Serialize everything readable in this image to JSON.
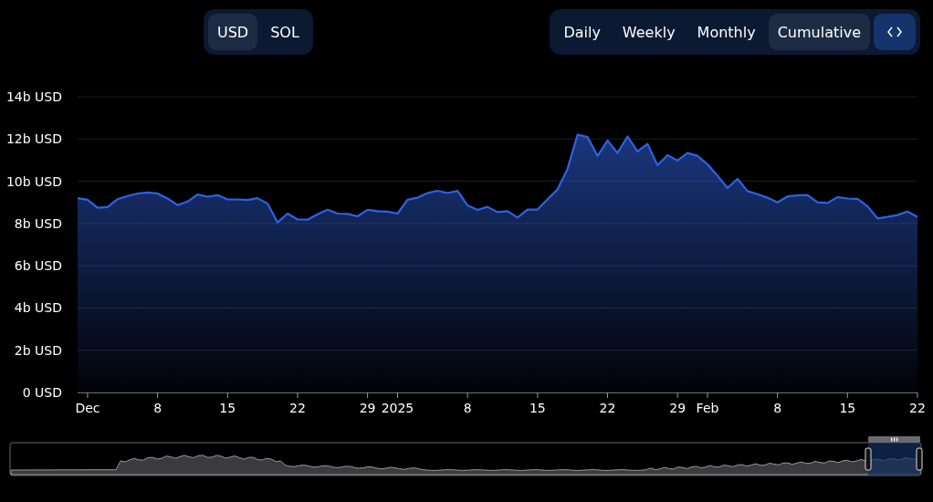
{
  "currency_toggle": [
    {
      "label": "USD",
      "selected": true
    },
    {
      "label": "SOL",
      "selected": false
    }
  ],
  "period_toggle": [
    {
      "label": "Daily",
      "selected": false
    },
    {
      "label": "Weekly",
      "selected": false
    },
    {
      "label": "Monthly",
      "selected": false
    },
    {
      "label": "Cumulative",
      "selected": true
    }
  ],
  "chart": {
    "chart_data": {
      "type": "area",
      "grid": true,
      "ylim": [
        0,
        14
      ],
      "xlim": [
        "2024-11-30",
        "2025-02-22"
      ],
      "x": [
        "2024-11-30",
        "2024-12-01",
        "2024-12-02",
        "2024-12-03",
        "2024-12-04",
        "2024-12-05",
        "2024-12-06",
        "2024-12-07",
        "2024-12-08",
        "2024-12-09",
        "2024-12-10",
        "2024-12-11",
        "2024-12-12",
        "2024-12-13",
        "2024-12-14",
        "2024-12-15",
        "2024-12-16",
        "2024-12-17",
        "2024-12-18",
        "2024-12-19",
        "2024-12-20",
        "2024-12-21",
        "2024-12-22",
        "2024-12-23",
        "2024-12-24",
        "2024-12-25",
        "2024-12-26",
        "2024-12-27",
        "2024-12-28",
        "2024-12-29",
        "2024-12-30",
        "2024-12-31",
        "2025-01-01",
        "2025-01-02",
        "2025-01-03",
        "2025-01-04",
        "2025-01-05",
        "2025-01-06",
        "2025-01-07",
        "2025-01-08",
        "2025-01-09",
        "2025-01-10",
        "2025-01-11",
        "2025-01-12",
        "2025-01-13",
        "2025-01-14",
        "2025-01-15",
        "2025-01-16",
        "2025-01-17",
        "2025-01-18",
        "2025-01-19",
        "2025-01-20",
        "2025-01-21",
        "2025-01-22",
        "2025-01-23",
        "2025-01-24",
        "2025-01-25",
        "2025-01-26",
        "2025-01-27",
        "2025-01-28",
        "2025-01-29",
        "2025-01-30",
        "2025-01-31",
        "2025-02-01",
        "2025-02-02",
        "2025-02-03",
        "2025-02-04",
        "2025-02-05",
        "2025-02-06",
        "2025-02-07",
        "2025-02-08",
        "2025-02-09",
        "2025-02-10",
        "2025-02-11",
        "2025-02-12",
        "2025-02-13",
        "2025-02-14",
        "2025-02-15",
        "2025-02-16",
        "2025-02-17",
        "2025-02-18",
        "2025-02-19",
        "2025-02-20",
        "2025-02-21",
        "2025-02-22"
      ],
      "yticks": [
        {
          "value": 0,
          "label": "0 USD"
        },
        {
          "value": 2,
          "label": "2b USD"
        },
        {
          "value": 4,
          "label": "4b USD"
        },
        {
          "value": 6,
          "label": "6b USD"
        },
        {
          "value": 8,
          "label": "8b USD"
        },
        {
          "value": 10,
          "label": "10b USD"
        },
        {
          "value": 12,
          "label": "12b USD"
        },
        {
          "value": 14,
          "label": "14b USD"
        }
      ],
      "xticks": [
        {
          "value": "2024-12-01",
          "label": "Dec"
        },
        {
          "value": "2024-12-08",
          "label": "8"
        },
        {
          "value": "2024-12-15",
          "label": "15"
        },
        {
          "value": "2024-12-22",
          "label": "22"
        },
        {
          "value": "2024-12-29",
          "label": "29"
        },
        {
          "value": "2025-01-01",
          "label": "2025"
        },
        {
          "value": "2025-01-08",
          "label": "8"
        },
        {
          "value": "2025-01-15",
          "label": "15"
        },
        {
          "value": "2025-01-22",
          "label": "22"
        },
        {
          "value": "2025-01-29",
          "label": "29"
        },
        {
          "value": "2025-02-01",
          "label": "Feb"
        },
        {
          "value": "2025-02-08",
          "label": "8"
        },
        {
          "value": "2025-02-15",
          "label": "15"
        },
        {
          "value": "2025-02-22",
          "label": "22"
        }
      ],
      "series": [
        {
          "color": "#2f62e3",
          "values": [
            9.2,
            9.12,
            8.74,
            8.78,
            9.15,
            9.3,
            9.42,
            9.47,
            9.42,
            9.18,
            8.87,
            9.04,
            9.37,
            9.27,
            9.34,
            9.14,
            9.14,
            9.11,
            9.2,
            8.94,
            8.05,
            8.47,
            8.19,
            8.18,
            8.44,
            8.65,
            8.47,
            8.45,
            8.34,
            8.65,
            8.58,
            8.56,
            8.47,
            9.12,
            9.22,
            9.44,
            9.55,
            9.44,
            9.54,
            8.86,
            8.64,
            8.79,
            8.54,
            8.58,
            8.28,
            8.66,
            8.66,
            9.15,
            9.61,
            10.59,
            12.2,
            12.1,
            11.2,
            11.93,
            11.34,
            12.12,
            11.41,
            11.77,
            10.76,
            11.24,
            10.98,
            11.34,
            11.21,
            10.8,
            10.26,
            9.68,
            10.11,
            9.53,
            9.39,
            9.22,
            9.0,
            9.28,
            9.33,
            9.35,
            9.0,
            8.97,
            9.25,
            9.18,
            9.17,
            8.82,
            8.24,
            8.31,
            8.4,
            8.57,
            8.31
          ]
        }
      ]
    }
  }
}
